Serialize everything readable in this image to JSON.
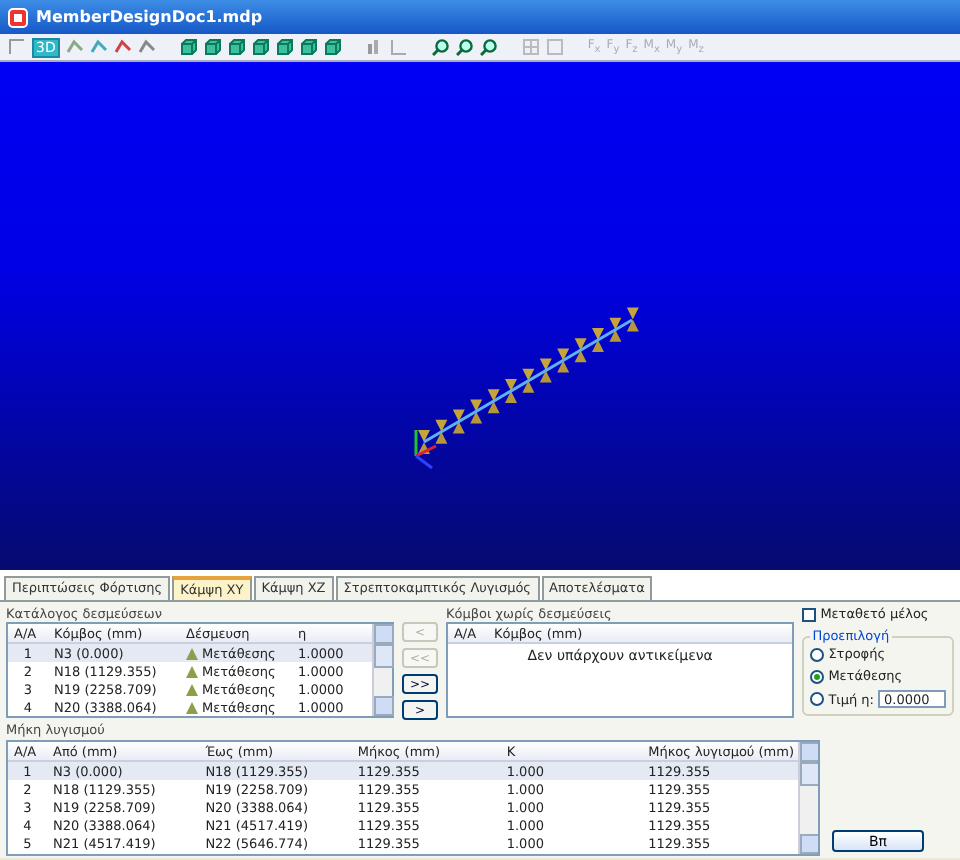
{
  "window": {
    "title": "MemberDesignDoc1.mdp"
  },
  "toolbar": {
    "view_button": {
      "label": "3D",
      "selected": true
    },
    "force_labels": [
      "F$_{x}$",
      "F$_{y}$",
      "F$_{z}$",
      "M$_{x}$",
      "M$_{y}$",
      "M$_{z}$"
    ]
  },
  "tabs": [
    {
      "label": "Περιπτώσεις Φόρτισης",
      "selected": false
    },
    {
      "label": "Κάμψη ΧΥ",
      "selected": true
    },
    {
      "label": "Κάμψη ΧΖ",
      "selected": false
    },
    {
      "label": "Στρεπτοκαμπτικός Λυγισμός",
      "selected": false
    },
    {
      "label": "Αποτελέσματα",
      "selected": false
    }
  ],
  "restraints": {
    "title": "Κατάλογος δεσμεύσεων",
    "columns": [
      "Α/Α",
      "Κόμβος (mm)",
      "Δέσμευση",
      "η"
    ],
    "rows": [
      {
        "cells": [
          "1",
          "N3 (0.000)",
          "Μετάθεσης",
          "1.0000"
        ],
        "selected": true
      },
      {
        "cells": [
          "2",
          "N18 (1129.355)",
          "Μετάθεσης",
          "1.0000"
        ],
        "selected": false
      },
      {
        "cells": [
          "3",
          "N19 (2258.709)",
          "Μετάθεσης",
          "1.0000"
        ],
        "selected": false
      },
      {
        "cells": [
          "4",
          "N20 (3388.064)",
          "Μετάθεσης",
          "1.0000"
        ],
        "selected": false
      }
    ]
  },
  "move_buttons": [
    {
      "label": "<",
      "disabled": true
    },
    {
      "label": "<<",
      "disabled": true
    },
    {
      "label": ">>",
      "disabled": false
    },
    {
      "label": ">",
      "disabled": false
    }
  ],
  "free_nodes": {
    "title": "Κόμβοι χωρίς δεσμεύσεις",
    "columns": [
      "Α/Α",
      "Κόμβος (mm)"
    ],
    "empty_text": "Δεν υπάρχουν αντικείμενα"
  },
  "sway_member": {
    "label": "Μεταθετό μέλος",
    "checked": false
  },
  "default_group": {
    "title": "Προεπιλογή",
    "options": [
      {
        "label": "Στροφής",
        "selected": false
      },
      {
        "label": "Μετάθεσης",
        "selected": true
      },
      {
        "label": "Τιμή η:",
        "selected": false
      }
    ],
    "value": "0.0000"
  },
  "lengths": {
    "title": "Μήκη λυγισμού",
    "columns": [
      "Α/Α",
      "Από (mm)",
      "Έως (mm)",
      "Μήκος (mm)",
      "K",
      "Μήκος λυγισμού (mm)"
    ],
    "rows": [
      {
        "cells": [
          "1",
          "N3 (0.000)",
          "N18 (1129.355)",
          "1129.355",
          "1.000",
          "1129.355"
        ],
        "selected": true
      },
      {
        "cells": [
          "2",
          "N18 (1129.355)",
          "N19 (2258.709)",
          "1129.355",
          "1.000",
          "1129.355"
        ],
        "selected": false
      },
      {
        "cells": [
          "3",
          "N19 (2258.709)",
          "N20 (3388.064)",
          "1129.355",
          "1.000",
          "1129.355"
        ],
        "selected": false
      },
      {
        "cells": [
          "4",
          "N20 (3388.064)",
          "N21 (4517.419)",
          "1129.355",
          "1.000",
          "1129.355"
        ],
        "selected": false
      },
      {
        "cells": [
          "5",
          "N21 (4517.419)",
          "N22 (5646.774)",
          "1129.355",
          "1.000",
          "1129.355"
        ],
        "selected": false
      }
    ]
  },
  "action_button": {
    "label": "Βπ"
  }
}
